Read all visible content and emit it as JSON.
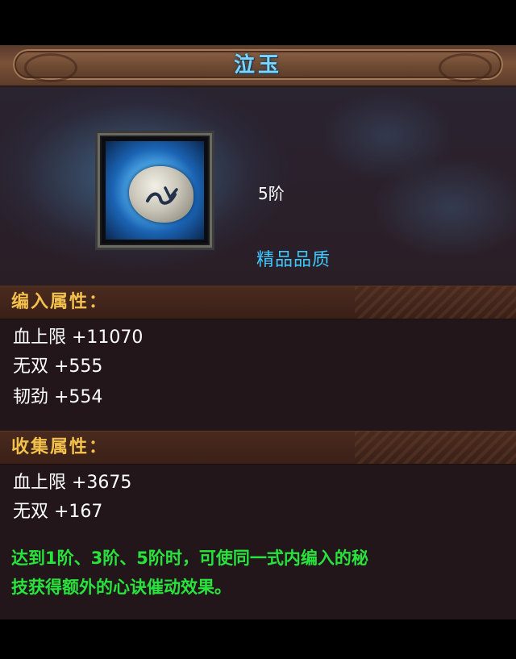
{
  "dialog": {
    "title": "泣玉"
  },
  "item": {
    "tier": "5阶",
    "quality": "精品品质",
    "icon": "moon-stone-icon"
  },
  "embed_section": {
    "title": "编入属性：",
    "stats": [
      {
        "text": "血上限 +11070"
      },
      {
        "text": "无双 +555"
      },
      {
        "text": "韧劲 +554"
      }
    ]
  },
  "collect_section": {
    "title": "收集属性：",
    "stats": [
      {
        "text": "血上限 +3675"
      },
      {
        "text": "无双 +167"
      }
    ]
  },
  "description": {
    "line1": "达到1阶、3阶、5阶时，可使同一式内编入的秘",
    "line2": "技获得额外的心诀催动效果。"
  },
  "colors": {
    "title": "#7ad5ff",
    "quality": "#3fc8ff",
    "section_title": "#f3c04b",
    "description": "#27e43d",
    "stat": "#ffffff"
  }
}
